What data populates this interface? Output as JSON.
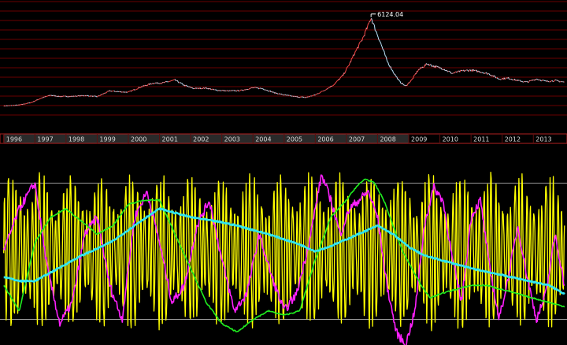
{
  "chart_data": [
    {
      "type": "line",
      "panel": "price",
      "annotation": {
        "text": "6124.04",
        "x": 2007.79,
        "y": 6124.04
      },
      "grid": "horizontal",
      "colors": {
        "price_up": "#ff4a4a",
        "price_down": "#bde8ff",
        "grid": "#6a0000",
        "background": "#000000"
      },
      "series": [
        {
          "x": [
            1996.0,
            1996.5,
            1996.9,
            1997.2,
            1997.5,
            1997.8,
            1998.2,
            1998.6,
            1999.0,
            1999.4,
            1999.7,
            2000.0,
            2000.4,
            2000.8,
            2001.1,
            2001.5,
            2001.8,
            2002.1,
            2002.5,
            2002.8,
            2003.2,
            2003.6,
            2004.0,
            2004.3,
            2004.7,
            2005.0,
            2005.4,
            2005.7,
            2006.0,
            2006.3,
            2006.6,
            2006.9,
            2007.1,
            2007.3,
            2007.5,
            2007.7,
            2007.79,
            2007.9,
            2008.1,
            2008.3,
            2008.5,
            2008.7,
            2008.9,
            2009.1,
            2009.3,
            2009.6,
            2009.8,
            2010.1,
            2010.4,
            2010.7,
            2011.0,
            2011.3,
            2011.6,
            2011.9,
            2012.2,
            2012.5,
            2012.8,
            2013.1,
            2013.4,
            2013.7,
            2014.0
          ],
          "y": [
            550,
            620,
            780,
            1050,
            1230,
            1150,
            1160,
            1210,
            1140,
            1500,
            1450,
            1420,
            1750,
            1990,
            2000,
            2180,
            1850,
            1650,
            1680,
            1550,
            1500,
            1520,
            1700,
            1650,
            1380,
            1250,
            1130,
            1090,
            1250,
            1550,
            1900,
            2500,
            3200,
            4000,
            4700,
            5600,
            6124.04,
            5500,
            4500,
            3400,
            2700,
            2100,
            1800,
            2200,
            2800,
            3200,
            3050,
            2900,
            2600,
            2750,
            2800,
            2700,
            2550,
            2250,
            2300,
            2150,
            2050,
            2250,
            2100,
            2150,
            2050
          ]
        }
      ],
      "xlim": [
        1995.88,
        2014.08
      ],
      "ylim": [
        -600,
        7200
      ]
    },
    {
      "type": "line",
      "panel": "timeline",
      "categories": [
        "1996",
        "1997",
        "1998",
        "1999",
        "2000",
        "2001",
        "2002",
        "2003",
        "2004",
        "2005",
        "2006",
        "2007",
        "2008",
        "2009",
        "2010",
        "2011",
        "2012",
        "2013"
      ],
      "selection": [
        1996,
        2009
      ],
      "colors": {
        "bar_fill": "#2a2a2a",
        "bar_border": "#b02020",
        "label": "#d8d8d8"
      }
    },
    {
      "type": "line",
      "panel": "oscillators",
      "ylim": [
        -110,
        110
      ],
      "reference_lines": [
        80,
        -80
      ],
      "grid": "none",
      "series": [
        {
          "color": "#ffff00",
          "period": 0.125,
          "amplitude": 88,
          "x": [
            1996.0,
            2014.0
          ]
        },
        {
          "color": "#ff20ff",
          "x": [
            1996.0,
            1996.5,
            1997.0,
            1997.4,
            1997.8,
            1998.2,
            1998.6,
            1999.0,
            1999.4,
            1999.8,
            2000.2,
            2000.6,
            2001.0,
            2001.4,
            2001.8,
            2002.2,
            2002.6,
            2003.0,
            2003.4,
            2003.8,
            2004.2,
            2004.6,
            2005.0,
            2005.4,
            2005.8,
            2006.2,
            2006.5,
            2006.8,
            2007.1,
            2007.4,
            2007.7,
            2008.0,
            2008.3,
            2008.6,
            2008.9,
            2009.2,
            2009.5,
            2009.8,
            2010.1,
            2010.4,
            2010.7,
            2011.0,
            2011.3,
            2011.6,
            2011.9,
            2012.2,
            2012.5,
            2012.8,
            2013.1,
            2013.4,
            2013.7,
            2014.0
          ],
          "y": [
            0,
            50,
            80,
            -20,
            -85,
            -60,
            20,
            40,
            -40,
            -80,
            40,
            70,
            10,
            -60,
            -40,
            30,
            60,
            -10,
            -70,
            -50,
            20,
            -30,
            -70,
            -50,
            10,
            90,
            60,
            20,
            50,
            60,
            70,
            40,
            -40,
            -95,
            -110,
            -70,
            30,
            75,
            60,
            -10,
            -60,
            40,
            60,
            -20,
            -80,
            -30,
            30,
            -30,
            -80,
            -50,
            20,
            -40
          ]
        },
        {
          "color": "#20ee20",
          "x": [
            1996.0,
            1996.5,
            1997.0,
            1997.5,
            1998.0,
            1998.5,
            1999.0,
            1999.5,
            2000.0,
            2000.5,
            2001.0,
            2001.5,
            2002.0,
            2002.5,
            2003.0,
            2003.5,
            2004.0,
            2004.5,
            2005.0,
            2005.5,
            2006.0,
            2006.5,
            2007.0,
            2007.3,
            2007.6,
            2007.9,
            2008.2,
            2008.5,
            2008.8,
            2009.1,
            2009.4,
            2009.7,
            2010.0,
            2010.5,
            2011.0,
            2011.5,
            2012.0,
            2012.5,
            2013.0,
            2013.5,
            2014.0
          ],
          "y": [
            -40,
            -70,
            10,
            40,
            50,
            35,
            20,
            30,
            55,
            60,
            60,
            20,
            -20,
            -60,
            -85,
            -95,
            -80,
            -70,
            -75,
            -70,
            -10,
            40,
            60,
            75,
            85,
            80,
            60,
            30,
            0,
            -20,
            -40,
            -55,
            -50,
            -45,
            -40,
            -40,
            -45,
            -50,
            -55,
            -60,
            -65
          ]
        },
        {
          "color": "#30e6f0",
          "x": [
            1996.0,
            1996.5,
            1997.0,
            1997.5,
            1998.0,
            1998.5,
            1999.0,
            1999.5,
            2000.0,
            2000.5,
            2001.0,
            2001.5,
            2002.0,
            2002.5,
            2003.0,
            2003.5,
            2004.0,
            2004.5,
            2005.0,
            2005.5,
            2006.0,
            2006.5,
            2007.0,
            2007.5,
            2008.0,
            2008.5,
            2009.0,
            2009.5,
            2010.0,
            2010.5,
            2011.0,
            2011.5,
            2012.0,
            2012.5,
            2013.0,
            2013.5,
            2014.0
          ],
          "y": [
            -30,
            -35,
            -35,
            -25,
            -15,
            -5,
            3,
            12,
            25,
            38,
            50,
            45,
            40,
            37,
            34,
            30,
            25,
            20,
            14,
            8,
            0,
            6,
            14,
            22,
            30,
            20,
            5,
            -5,
            -10,
            -15,
            -20,
            -24,
            -28,
            -32,
            -36,
            -40,
            -50
          ]
        }
      ],
      "xlim": [
        1995.88,
        2014.08
      ]
    }
  ]
}
